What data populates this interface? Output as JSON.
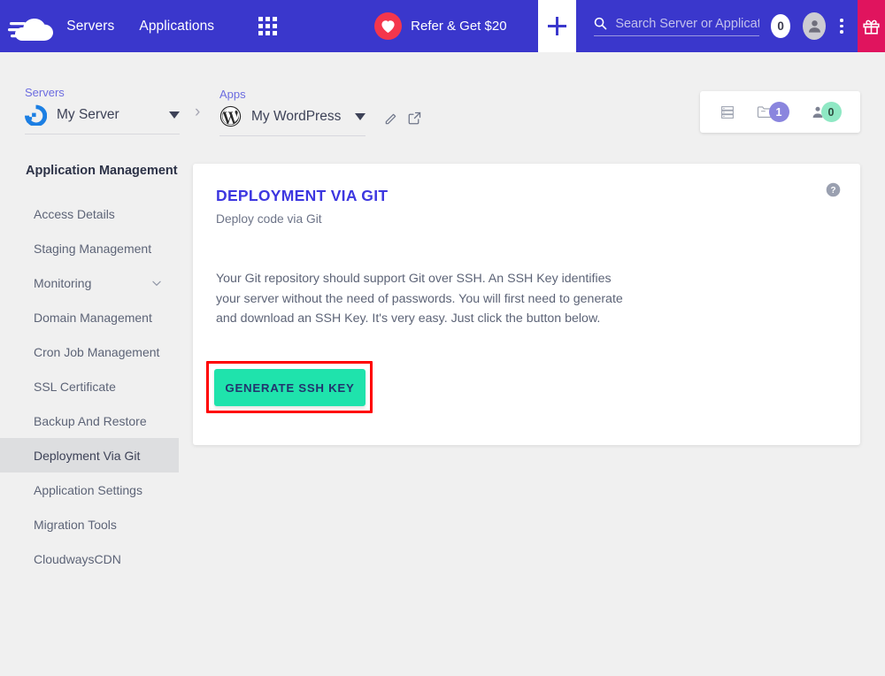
{
  "navbar": {
    "logo": "cloudways-logo",
    "links": [
      {
        "label": "Servers"
      },
      {
        "label": "Applications"
      }
    ],
    "grid_icon": "app-grid-icon",
    "refer": {
      "label": "Refer & Get $20",
      "icon": "heart-icon"
    },
    "add_icon": "plus-icon",
    "search": {
      "placeholder": "Search Server or Application",
      "value": "",
      "icon": "search-icon"
    },
    "notification_count": "0",
    "avatar": "user-avatar-icon",
    "kebab": "more-options-icon",
    "gift": "gift-icon",
    "colors": {
      "bar": "#3a37cc",
      "heart": "#f4364c",
      "gift": "#e0145e"
    }
  },
  "breadcrumb": {
    "server": {
      "label": "Servers",
      "name": "My Server",
      "icon": "digitalocean-icon"
    },
    "separator": "›",
    "app": {
      "label": "Apps",
      "name": "My WordPress",
      "icon": "wordpress-icon"
    },
    "actions": {
      "edit": "pencil-icon",
      "launch": "external-link-icon"
    }
  },
  "stat_card": {
    "items": [
      {
        "icon": "server-stack-icon",
        "value": ""
      },
      {
        "icon": "folder-icon",
        "value": "1",
        "badge_color": "#8a85de"
      },
      {
        "icon": "user-icon",
        "value": "0",
        "badge_color": "#8fe8c4"
      }
    ]
  },
  "sidebar": {
    "title": "Application Management",
    "items": [
      {
        "label": "Access Details",
        "active": false,
        "expandable": false
      },
      {
        "label": "Staging Management",
        "active": false,
        "expandable": false
      },
      {
        "label": "Monitoring",
        "active": false,
        "expandable": true
      },
      {
        "label": "Domain Management",
        "active": false,
        "expandable": false
      },
      {
        "label": "Cron Job Management",
        "active": false,
        "expandable": false
      },
      {
        "label": "SSL Certificate",
        "active": false,
        "expandable": false
      },
      {
        "label": "Backup And Restore",
        "active": false,
        "expandable": false
      },
      {
        "label": "Deployment Via Git",
        "active": true,
        "expandable": false
      },
      {
        "label": "Application Settings",
        "active": false,
        "expandable": false
      },
      {
        "label": "Migration Tools",
        "active": false,
        "expandable": false
      },
      {
        "label": "CloudwaysCDN",
        "active": false,
        "expandable": false
      }
    ]
  },
  "card": {
    "title": "DEPLOYMENT VIA GIT",
    "subtitle": "Deploy code via Git",
    "body": "Your Git repository should support Git over SSH. An SSH Key identifies your server without the need of passwords. You will first need to generate and download an SSH Key. It's very easy. Just click the button below.",
    "help_icon": "help-question-icon",
    "title_color": "#3d37e0"
  },
  "generate_button": {
    "label": "GENERATE SSH KEY",
    "color": "#1fe3ac",
    "highlight_color": "#ff0000",
    "highlighted": true
  }
}
